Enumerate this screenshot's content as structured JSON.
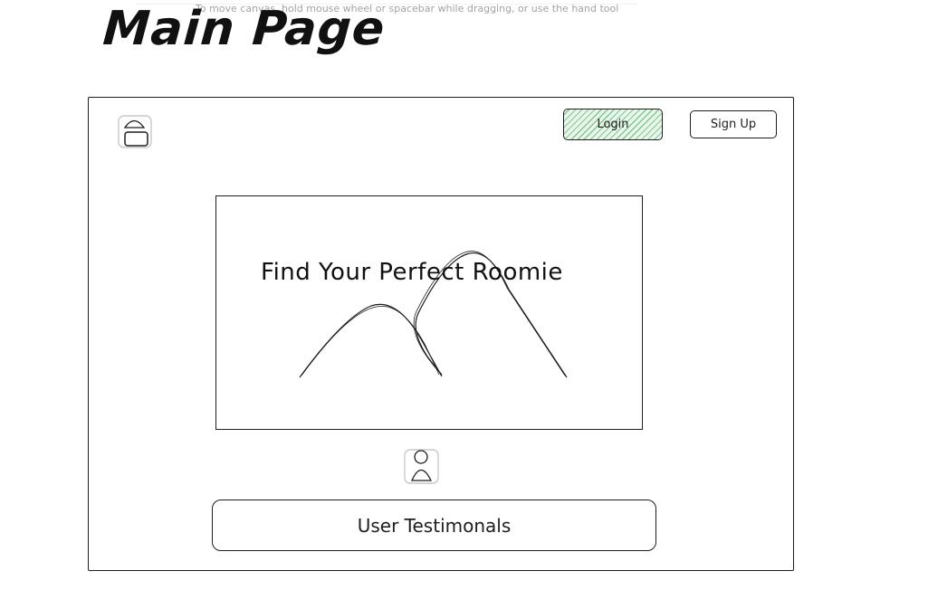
{
  "canvas_hint": "To move canvas, hold mouse wheel or spacebar while dragging, or use the hand tool",
  "page_title": "Main Page",
  "header": {
    "logo_icon": "logo-placeholder-icon",
    "login_label": "Login",
    "signup_label": "Sign Up"
  },
  "hero": {
    "headline": "Find Your Perfect Roomie",
    "image_icon": "mountain-image-placeholder-icon"
  },
  "testimonials": {
    "avatar_icon": "user-avatar-icon",
    "label": "User Testimonals"
  },
  "colors": {
    "stroke": "#1e1e1e",
    "login_fill": "#2f9e44",
    "hint_text": "#a3a3a3"
  }
}
